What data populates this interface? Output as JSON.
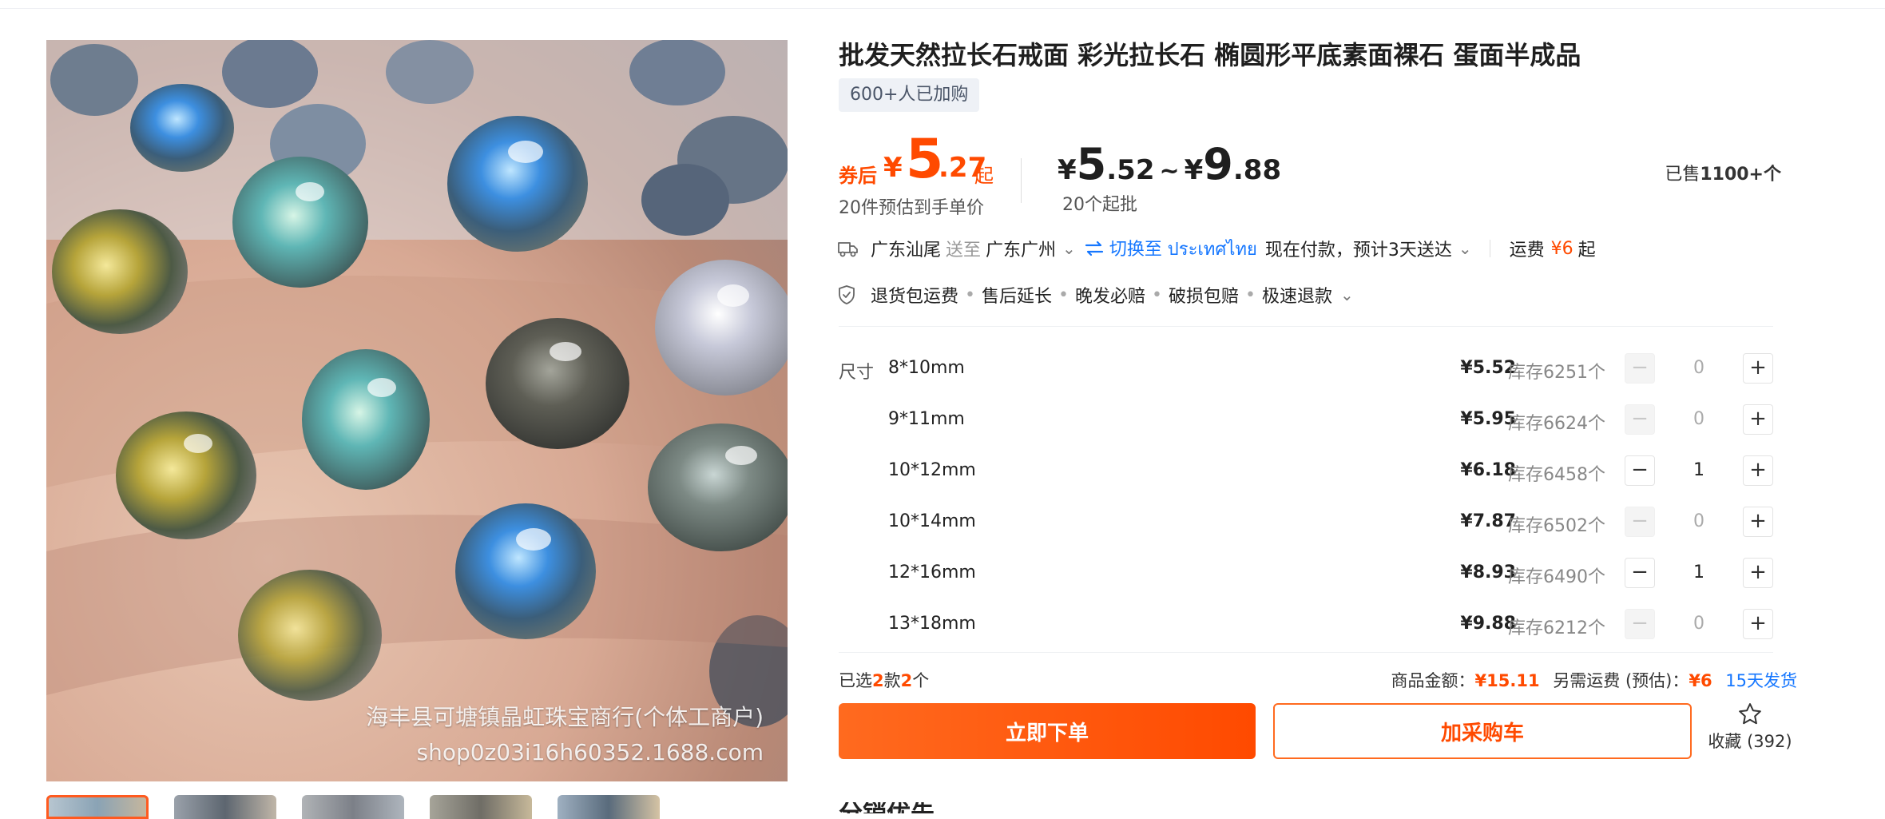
{
  "product": {
    "title": "批发天然拉长石戒面 彩光拉长石 椭圆形平底素面裸石 蛋面半成品",
    "buyers_tag": "600+人已加购",
    "watermark_shop": "海丰县可塘镇晶虹珠宝商行(个体工商户)",
    "watermark_url": "shop0z03i16h60352.1688.com"
  },
  "price": {
    "coupon_label": "券后",
    "currency": "¥",
    "coupon_int": "5",
    "coupon_dec": ".27",
    "coupon_suffix": "起",
    "estimate_note": "20件预估到手单价",
    "range_low_int": "5",
    "range_low_dec": ".52",
    "range_tilde": "~",
    "range_high_int": "9",
    "range_high_dec": ".88",
    "min_batch": "20个起批",
    "sold_prefix": "已售",
    "sold_value": "1100+个"
  },
  "shipping": {
    "from": "广东汕尾",
    "to_label": "送至",
    "to": "广东广州",
    "switch_label": "切换至 ประเทศไทย",
    "eta": "现在付款，预计3天送达",
    "fee_label": "运费",
    "fee_value": "¥6",
    "fee_suffix": "起"
  },
  "services": [
    "退货包运费",
    "售后延长",
    "晚发必赔",
    "破损包赔",
    "极速退款"
  ],
  "spec_label": "尺寸",
  "skus": [
    {
      "name": "8*10mm",
      "price": "¥5.52",
      "stock": "库存6251个",
      "qty": "0",
      "minus": "−",
      "plus": "+"
    },
    {
      "name": "9*11mm",
      "price": "¥5.95",
      "stock": "库存6624个",
      "qty": "0",
      "minus": "−",
      "plus": "+"
    },
    {
      "name": "10*12mm",
      "price": "¥6.18",
      "stock": "库存6458个",
      "qty": "1",
      "minus": "−",
      "plus": "+"
    },
    {
      "name": "10*14mm",
      "price": "¥7.87",
      "stock": "库存6502个",
      "qty": "0",
      "minus": "−",
      "plus": "+"
    },
    {
      "name": "12*16mm",
      "price": "¥8.93",
      "stock": "库存6490个",
      "qty": "1",
      "minus": "−",
      "plus": "+"
    },
    {
      "name": "13*18mm",
      "price": "¥9.88",
      "stock": "库存6212个",
      "qty": "0",
      "minus": "−",
      "plus": "+"
    }
  ],
  "summary": {
    "selected_prefix": "已选",
    "selected_kinds": "2",
    "selected_mid": "款",
    "selected_count": "2",
    "selected_suffix": "个",
    "amount_label": "商品金额：",
    "amount_value": "¥15.11",
    "shipping_label": "另需运费 (预估)：",
    "shipping_value": "¥6",
    "dispatch": "15天发货"
  },
  "actions": {
    "order": "立即下单",
    "cart": "加采购车",
    "favorite": "收藏 (392)"
  },
  "next_section_peek": "分销优先",
  "colors": {
    "accent": "#ff4a00",
    "link": "#1677ff"
  },
  "icons": [
    "truck-icon",
    "swap-icon",
    "chevron-down-icon",
    "shield-check-icon",
    "star-icon",
    "minus-icon",
    "plus-icon"
  ]
}
